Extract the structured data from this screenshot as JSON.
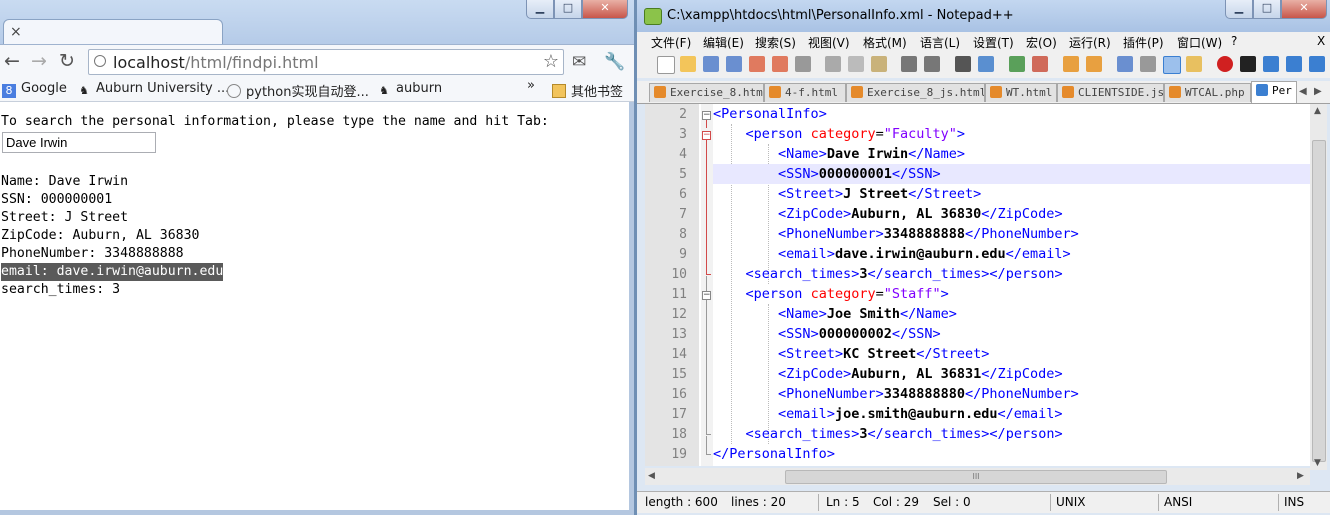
{
  "chrome": {
    "tab_title": "",
    "tab_close": "×",
    "url_host": "localhost",
    "url_path": "/html/findpi.html",
    "bookmarks": [
      {
        "label": "Google",
        "icon": "google-icon"
      },
      {
        "label": "Auburn University ...",
        "icon": "auburn-icon"
      },
      {
        "label": "python实现自动登...",
        "icon": "globe-icon"
      },
      {
        "label": "auburn",
        "icon": "auburn-icon"
      }
    ],
    "bookmarks_overflow": "»",
    "other_bookmarks": "其他书签",
    "page": {
      "prompt": "To search the personal information, please type the name and hit Tab:",
      "input_value": "Dave Irwin",
      "results": [
        "Name: Dave Irwin",
        "SSN: 000000001",
        "Street: J Street",
        "ZipCode: Auburn, AL 36830",
        "PhoneNumber: 3348888888",
        "email: dave.irwin@auburn.edu",
        "search_times: 3"
      ]
    }
  },
  "npp": {
    "title": "C:\\xampp\\htdocs\\html\\PersonalInfo.xml - Notepad++",
    "menu": [
      "文件(F)",
      "编辑(E)",
      "搜索(S)",
      "视图(V)",
      "格式(M)",
      "语言(L)",
      "设置(T)",
      "宏(O)",
      "运行(R)",
      "插件(P)",
      "窗口(W)",
      "?"
    ],
    "menu_close": "X",
    "tabs": [
      "Exercise_8.html",
      "4-f.html",
      "Exercise_8_js.html",
      "WT.html",
      "CLIENTSIDE.js",
      "WTCAL.php",
      "Per"
    ],
    "line_numbers": [
      "2",
      "3",
      "4",
      "5",
      "6",
      "7",
      "8",
      "9",
      "10",
      "11",
      "12",
      "13",
      "14",
      "15",
      "16",
      "17",
      "18",
      "19"
    ],
    "code": {
      "root_open": "PersonalInfo",
      "root_close": "PersonalInfo",
      "person_tag": "person",
      "category_attr": "category",
      "persons": [
        {
          "category": "\"Faculty\"",
          "name": "Dave Irwin",
          "ssn": "000000001",
          "street": "J Street",
          "zipcode": "Auburn, AL 36830",
          "phone": "3348888888",
          "email": "dave.irwin@auburn.edu",
          "search_times": "3"
        },
        {
          "category": "\"Staff\"",
          "name": "Joe Smith",
          "ssn": "000000002",
          "street": "KC Street",
          "zipcode": "Auburn, AL 36831",
          "phone": "3348888880",
          "email": "joe.smith@auburn.edu",
          "search_times": "3"
        }
      ],
      "tags": {
        "name": "Name",
        "ssn": "SSN",
        "street": "Street",
        "zipcode": "ZipCode",
        "phone": "PhoneNumber",
        "email": "email",
        "search_times": "search_times"
      }
    },
    "status": {
      "length": "length : 600",
      "lines": "lines : 20",
      "ln": "Ln : 5",
      "col": "Col : 29",
      "sel": "Sel : 0",
      "eol": "UNIX",
      "encoding": "ANSI",
      "mode": "INS"
    },
    "hscroll_grip": "III"
  },
  "colors": {
    "xml_tag": "#0000ff",
    "xml_attr": "#ff0000",
    "xml_value": "#8000ff",
    "current_line": "#e8e8ff",
    "selection": "#5a5a5a"
  }
}
